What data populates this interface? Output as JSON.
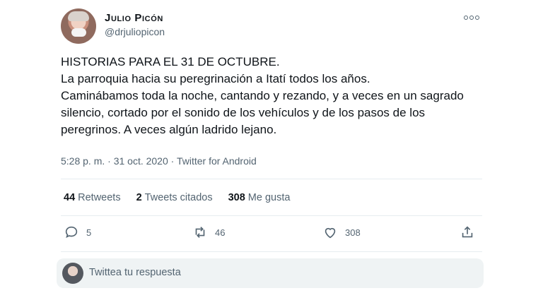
{
  "tweet": {
    "author": {
      "display_name": "Julio Picón",
      "handle": "@drjuliopicon"
    },
    "text": "HISTORIAS PARA EL 31 DE OCTUBRE.\nLa parroquia hacia su peregrinación a Itatí todos los años.\nCaminábamos toda la noche, cantando y rezando, y a veces en un sagrado silencio, cortado por el sonido de los vehículos y de los pasos de los peregrinos. A veces algún ladrido lejano.",
    "meta": "5:28 p. m. · 31 oct. 2020 · Twitter for Android",
    "stats": {
      "retweets_count": "44",
      "retweets_label": "Retweets",
      "quotes_count": "2",
      "quotes_label": "Tweets citados",
      "likes_count": "308",
      "likes_label": "Me gusta"
    },
    "actions": {
      "reply_count": "5",
      "retweet_count": "46",
      "like_count": "308"
    }
  },
  "reply_box": {
    "placeholder": "Twittea tu respuesta"
  },
  "icons": {
    "more": "more-horizontal-icon",
    "reply": "reply-icon",
    "retweet": "retweet-icon",
    "like": "heart-icon",
    "share": "share-icon"
  }
}
